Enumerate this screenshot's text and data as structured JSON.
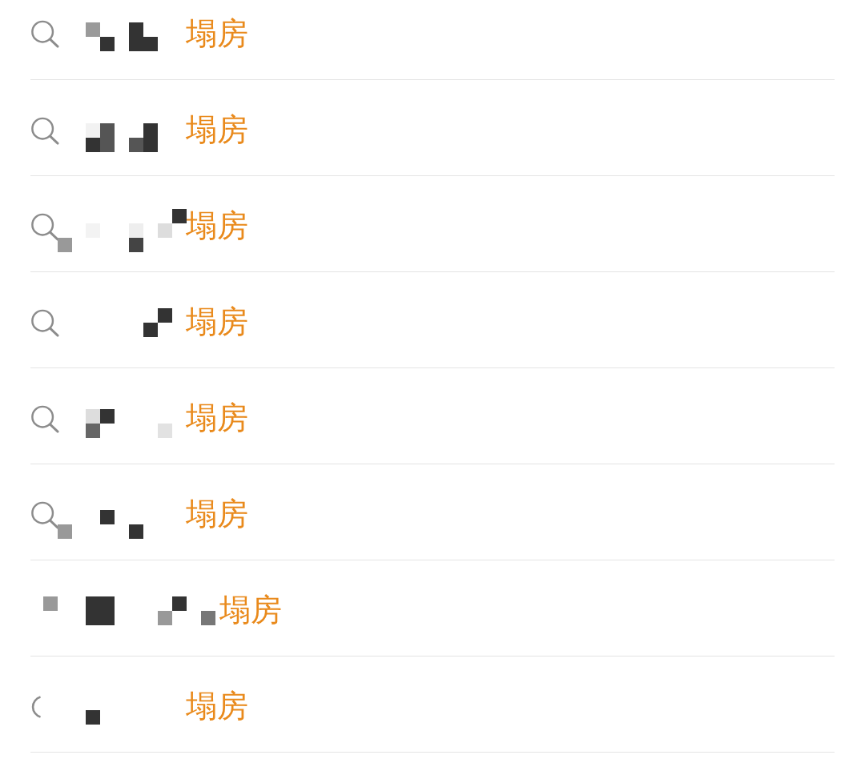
{
  "suggestions": [
    {
      "keyword": "塌房"
    },
    {
      "keyword": "塌房"
    },
    {
      "keyword": "塌房"
    },
    {
      "keyword": "塌房"
    },
    {
      "keyword": "塌房"
    },
    {
      "keyword": "塌房"
    },
    {
      "keyword": "塌房"
    },
    {
      "keyword": "塌房"
    }
  ]
}
